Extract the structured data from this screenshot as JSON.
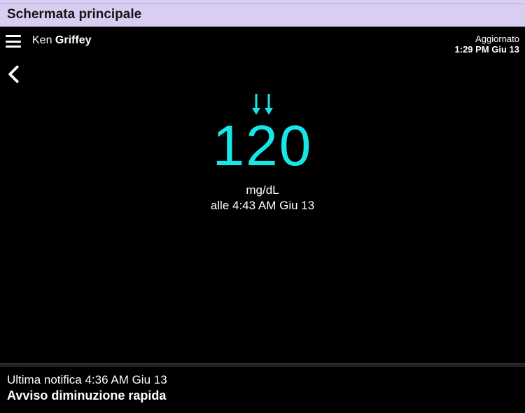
{
  "titleBar": {
    "title": "Schermata principale"
  },
  "header": {
    "user": {
      "first": "Ken",
      "last": "Griffey"
    },
    "updated": {
      "label": "Aggiornato",
      "timestamp": "1:29 PM Giu 13"
    }
  },
  "reading": {
    "value": "120",
    "unit": "mg/dL",
    "timestamp": "alle 4:43 AM Giu 13",
    "trend": "falling-rapidly",
    "color": "#17e6e6"
  },
  "footer": {
    "lastNotification": "Ultima notifica 4:36 AM Giu 13",
    "alertTitle": "Avviso diminuzione rapida"
  }
}
